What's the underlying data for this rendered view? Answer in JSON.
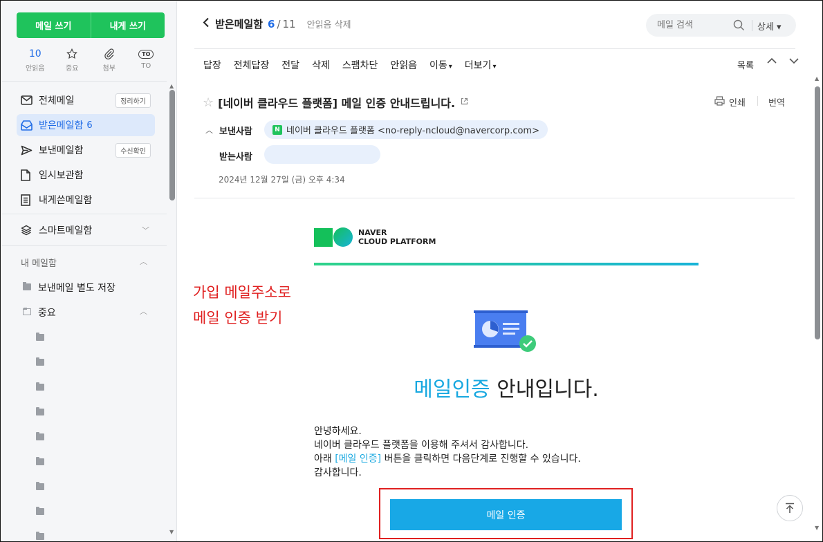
{
  "sidebar": {
    "write_mail": "메일 쓰기",
    "write_to_me": "내게 쓰기",
    "quick": [
      {
        "top": "10",
        "label": "안읽음",
        "icon": "unread-count"
      },
      {
        "top": "",
        "label": "중요",
        "icon": "star-icon"
      },
      {
        "top": "",
        "label": "첨부",
        "icon": "paperclip-icon"
      },
      {
        "top": "TO",
        "label": "TO",
        "icon": "to-badge"
      }
    ],
    "items": [
      {
        "label": "전체메일",
        "pill": "정리하기",
        "icon": "mail-icon"
      },
      {
        "label": "받은메일함",
        "count": "6",
        "icon": "inbox-icon"
      },
      {
        "label": "보낸메일함",
        "pill": "수신확인",
        "icon": "send-icon"
      },
      {
        "label": "임시보관함",
        "icon": "draft-icon"
      },
      {
        "label": "내게쓴메일함",
        "icon": "note-icon"
      },
      {
        "label": "스마트메일함",
        "icon": "layers-icon"
      }
    ],
    "my_mailbox": "내 메일함",
    "folders": [
      {
        "label": "보낸메일 별도 저장"
      },
      {
        "label": "중요"
      }
    ]
  },
  "header": {
    "title": "받은메일함",
    "current": "6",
    "total": "11",
    "unread_delete": "안읽음 삭제",
    "search_placeholder": "메일 검색",
    "detail": "상세"
  },
  "toolbar": {
    "items": [
      "답장",
      "전체답장",
      "전달",
      "삭제",
      "스팸차단",
      "안읽음",
      "이동",
      "더보기"
    ],
    "list": "목록"
  },
  "message": {
    "subject": "[네이버 클라우드 플랫폼] 메일 인증 안내드립니다.",
    "print": "인쇄",
    "translate": "번역",
    "from_label": "보낸사람",
    "from_value": "네이버 클라우드 플랫폼 <no-reply-ncloud@navercorp.com>",
    "to_label": "받는사람",
    "to_value": "",
    "date": "2024년 12월 27일 (금) 오후 4:34"
  },
  "email_body": {
    "logo_line1": "NAVER",
    "logo_line2": "CLOUD PLATFORM",
    "title_highlight": "메일인증",
    "title_rest": " 안내입니다.",
    "greeting": "안녕하세요.",
    "line2": "네이버 클라우드 플랫폼을 이용해 주셔서 감사합니다.",
    "line3_pre": "아래 ",
    "line3_link": "[메일 인증]",
    "line3_post": " 버튼을 클릭하면 다음단계로 진행할 수 있습니다.",
    "line4": "감사합니다.",
    "cta": "메일 인증"
  },
  "annotation": {
    "line1": "가입 메일주소로",
    "line2": "메일 인증 받기"
  },
  "colors": {
    "brand_green": "#1fc35c",
    "accent_blue": "#1e6be6",
    "cta_blue": "#18a8e6",
    "annotation_red": "#e02020"
  }
}
